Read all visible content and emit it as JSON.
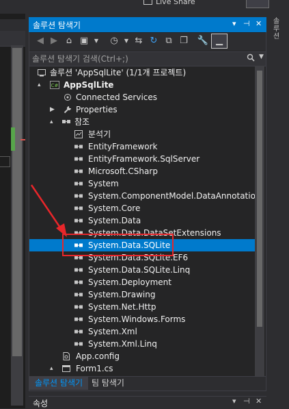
{
  "topbar": {
    "live_share": "Live Share",
    "account_button": "",
    "far_right_text": "솔루션"
  },
  "solution_explorer": {
    "title": "솔루션 탐색기",
    "title_buttons": [
      "▾",
      "⊣",
      "✕"
    ],
    "search_placeholder": "솔루션 탐색기 검색(Ctrl+;)",
    "tree": [
      {
        "label": "솔루션 'AppSqlLite' (1/1개 프로젝트)",
        "icon": "solution-icon",
        "expander": ""
      },
      {
        "label": "AppSqlLite",
        "icon": "csharp-project-icon",
        "expander": "▴",
        "bold": true
      },
      {
        "label": "Connected Services",
        "icon": "connected-services-icon",
        "expander": ""
      },
      {
        "label": "Properties",
        "icon": "wrench-icon",
        "expander": "▶"
      },
      {
        "label": "참조",
        "icon": "references-icon",
        "expander": "▴"
      },
      {
        "label": "분석기",
        "icon": "analyzer-icon",
        "expander": ""
      },
      {
        "label": "EntityFramework",
        "icon": "reference-icon",
        "expander": ""
      },
      {
        "label": "EntityFramework.SqlServer",
        "icon": "reference-icon",
        "expander": ""
      },
      {
        "label": "Microsoft.CSharp",
        "icon": "reference-icon",
        "expander": ""
      },
      {
        "label": "System",
        "icon": "reference-icon",
        "expander": ""
      },
      {
        "label": "System.ComponentModel.DataAnnotations",
        "icon": "reference-icon",
        "expander": ""
      },
      {
        "label": "System.Core",
        "icon": "reference-icon",
        "expander": ""
      },
      {
        "label": "System.Data",
        "icon": "reference-icon",
        "expander": ""
      },
      {
        "label": "System.Data.DataSetExtensions",
        "icon": "reference-icon",
        "expander": ""
      },
      {
        "label": "System.Data.SQLite",
        "icon": "reference-icon",
        "expander": "",
        "selected": true
      },
      {
        "label": "System.Data.SQLite.EF6",
        "icon": "reference-icon",
        "expander": ""
      },
      {
        "label": "System.Data.SQLite.Linq",
        "icon": "reference-icon",
        "expander": ""
      },
      {
        "label": "System.Deployment",
        "icon": "reference-icon",
        "expander": ""
      },
      {
        "label": "System.Drawing",
        "icon": "reference-icon",
        "expander": ""
      },
      {
        "label": "System.Net.Http",
        "icon": "reference-icon",
        "expander": ""
      },
      {
        "label": "System.Windows.Forms",
        "icon": "reference-icon",
        "expander": ""
      },
      {
        "label": "System.Xml",
        "icon": "reference-icon",
        "expander": ""
      },
      {
        "label": "System.Xml.Linq",
        "icon": "reference-icon",
        "expander": ""
      },
      {
        "label": "App.config",
        "icon": "config-file-icon",
        "expander": ""
      },
      {
        "label": "Form1.cs",
        "icon": "form-file-icon",
        "expander": "▴"
      }
    ],
    "tabs": [
      "솔루션 탐색기",
      "팀 탐색기"
    ]
  },
  "properties": {
    "title": "속성",
    "title_buttons": [
      "▾",
      "⊣",
      "✕"
    ]
  },
  "colors": {
    "accent": "#007acc",
    "selection": "#007acc",
    "annotation": "#e8262a",
    "background": "#252526"
  }
}
